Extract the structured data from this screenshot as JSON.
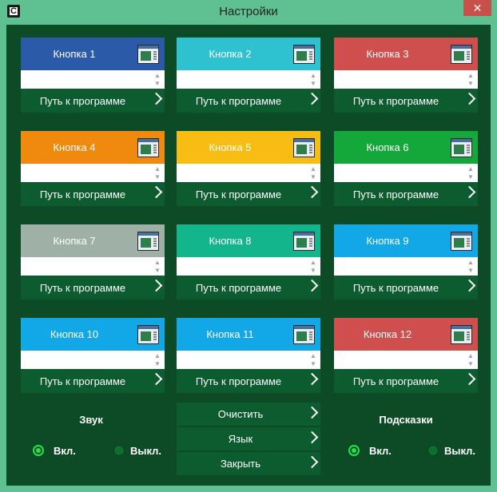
{
  "window": {
    "title": "Настройки",
    "close_glyph": "✕",
    "app_icon_glyph": "C"
  },
  "colors": {
    "background": "#0d4a26",
    "frame": "#5fc191",
    "path_bar": "#0d5c30",
    "radio_on": "#23e24a"
  },
  "cards": [
    {
      "label": "Кнопка 1",
      "color": "#2a5aa8",
      "text_color": "#ffffff",
      "field_value": "",
      "path_label": "Путь к программе"
    },
    {
      "label": "Кнопка 2",
      "color": "#2ec1d0",
      "text_color": "#ffffff",
      "field_value": "",
      "path_label": "Путь к программе"
    },
    {
      "label": "Кнопка 3",
      "color": "#cf4f4f",
      "text_color": "#ffffff",
      "field_value": "",
      "path_label": "Путь к программе"
    },
    {
      "label": "Кнопка 4",
      "color": "#f08a0e",
      "text_color": "#ffffff",
      "field_value": "",
      "path_label": "Путь к программе"
    },
    {
      "label": "Кнопка 5",
      "color": "#f7bd12",
      "text_color": "#ffffff",
      "field_value": "",
      "path_label": "Путь к программе"
    },
    {
      "label": "Кнопка 6",
      "color": "#14a83b",
      "text_color": "#ffffff",
      "field_value": "",
      "path_label": "Путь к программе"
    },
    {
      "label": "Кнопка 7",
      "color": "#9fb0a6",
      "text_color": "#ffffff",
      "field_value": "",
      "path_label": "Путь к программе"
    },
    {
      "label": "Кнопка 8",
      "color": "#13b58d",
      "text_color": "#ffffff",
      "field_value": "",
      "path_label": "Путь к программе"
    },
    {
      "label": "Кнопка 9",
      "color": "#12a8e8",
      "text_color": "#ffffff",
      "field_value": "",
      "path_label": "Путь к программе"
    },
    {
      "label": "Кнопка 10",
      "color": "#12a8e8",
      "text_color": "#ffffff",
      "field_value": "",
      "path_label": "Путь к программе"
    },
    {
      "label": "Кнопка 11",
      "color": "#12a8e8",
      "text_color": "#ffffff",
      "field_value": "",
      "path_label": "Путь к программе"
    },
    {
      "label": "Кнопка 12",
      "color": "#cf4f4f",
      "text_color": "#ffffff",
      "field_value": "",
      "path_label": "Путь к программе"
    }
  ],
  "sound": {
    "title": "Звук",
    "on_label": "Вкл.",
    "off_label": "Выкл.",
    "selected": "on"
  },
  "hints": {
    "title": "Подсказки",
    "on_label": "Вкл.",
    "off_label": "Выкл.",
    "selected": "on"
  },
  "actions": {
    "clear": "Очистить",
    "language": "Язык",
    "close": "Закрыть"
  },
  "icons": {
    "card_icon": "window-icon",
    "chevron": "chevron-right-icon",
    "scroll_up": "scroll-up-icon",
    "scroll_down": "scroll-down-icon"
  }
}
